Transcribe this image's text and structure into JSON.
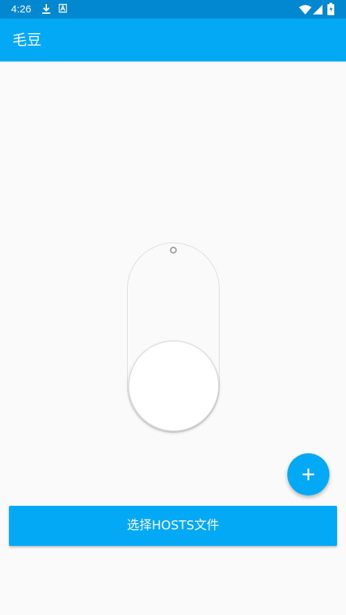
{
  "status_bar": {
    "time": "4:26",
    "icons": [
      "download-icon",
      "a-badge-icon",
      "wifi-icon",
      "signal-icon",
      "battery-icon"
    ],
    "background": "#0288d1"
  },
  "app_bar": {
    "title": "毛豆",
    "background": "#03a9f4"
  },
  "toggle_switch": {
    "state": "off"
  },
  "fab": {
    "icon": "plus-icon",
    "color": "#03a9f4"
  },
  "select_hosts_button": {
    "label": "选择HOSTS文件",
    "color": "#03a9f4"
  }
}
